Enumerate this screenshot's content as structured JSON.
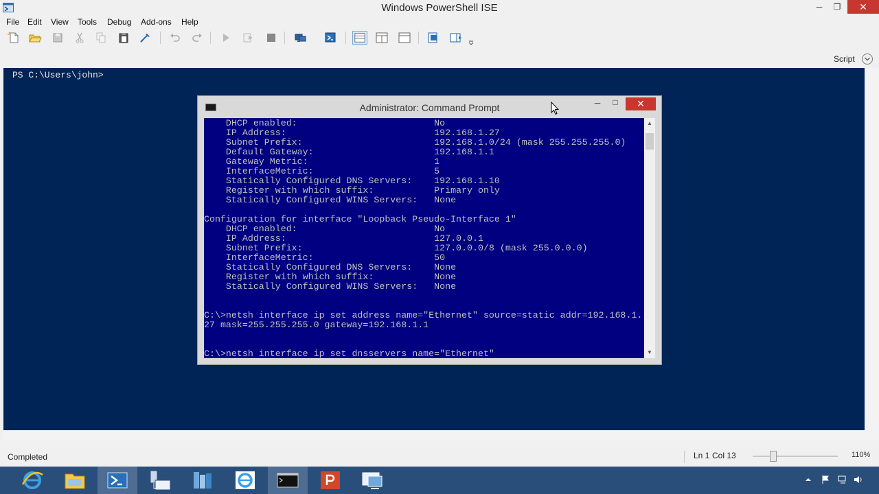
{
  "window": {
    "title": "Windows PowerShell ISE",
    "min_glyph": "─",
    "max_glyph": "❐",
    "close_glyph": "✕"
  },
  "menu": [
    "File",
    "Edit",
    "View",
    "Tools",
    "Debug",
    "Add-ons",
    "Help"
  ],
  "toolbar_icons": [
    "new-file-icon",
    "open-folder-icon",
    "save-icon",
    "cut-icon",
    "copy-icon",
    "paste-icon",
    "clear-console-icon",
    "undo-icon",
    "redo-icon",
    "run-script-icon",
    "run-selection-icon",
    "stop-icon",
    "new-remote-tab-icon",
    "start-powershell-icon",
    "script-pane-top-icon",
    "script-pane-right-icon",
    "script-pane-maximized-icon",
    "show-command-icon",
    "show-addon-icon",
    "toolbar-overflow-icon"
  ],
  "script_toggle": {
    "label": "Script"
  },
  "console": {
    "prompt": "PS C:\\Users\\john>"
  },
  "cmd": {
    "title": "Administrator: Command Prompt",
    "min_glyph": "─",
    "max_glyph": "□",
    "close_glyph": "✕",
    "lines": [
      "    DHCP enabled:                         No",
      "    IP Address:                           192.168.1.27",
      "    Subnet Prefix:                        192.168.1.0/24 (mask 255.255.255.0)",
      "    Default Gateway:                      192.168.1.1",
      "    Gateway Metric:                       1",
      "    InterfaceMetric:                      5",
      "    Statically Configured DNS Servers:    192.168.1.10",
      "    Register with which suffix:           Primary only",
      "    Statically Configured WINS Servers:   None",
      "",
      "Configuration for interface \"Loopback Pseudo-Interface 1\"",
      "    DHCP enabled:                         No",
      "    IP Address:                           127.0.0.1",
      "    Subnet Prefix:                        127.0.0.0/8 (mask 255.0.0.0)",
      "    InterfaceMetric:                      50",
      "    Statically Configured DNS Servers:    None",
      "    Register with which suffix:           None",
      "    Statically Configured WINS Servers:   None",
      "",
      "",
      "C:\\>netsh interface ip set address name=\"Ethernet\" source=static addr=192.168.1.",
      "27 mask=255.255.255.0 gateway=192.168.1.1",
      "",
      "",
      "C:\\>netsh interface ip set dnsservers name=\"Ethernet\""
    ]
  },
  "status": {
    "text": "Completed",
    "line": "Ln 1",
    "col": "Col 13",
    "zoom": "110%",
    "zoom_percent": 110
  },
  "taskbar": {
    "apps": [
      {
        "name": "taskbar-internet-explorer",
        "icon": "ie-icon",
        "active": false
      },
      {
        "name": "taskbar-file-explorer",
        "icon": "folder-icon",
        "active": false
      },
      {
        "name": "taskbar-powershell",
        "icon": "powershell-icon",
        "active": true
      },
      {
        "name": "taskbar-network",
        "icon": "network-computer-icon",
        "active": false
      },
      {
        "name": "taskbar-server-manager",
        "icon": "server-manager-icon",
        "active": false
      },
      {
        "name": "taskbar-internet-explorer-2",
        "icon": "ie-icon",
        "active": false
      },
      {
        "name": "taskbar-command-prompt",
        "icon": "cmd-icon",
        "active": true
      },
      {
        "name": "taskbar-powerpoint",
        "icon": "powerpoint-icon",
        "active": false
      },
      {
        "name": "taskbar-remote-desktop",
        "icon": "remote-desktop-icon",
        "active": false
      }
    ],
    "tray_icons": [
      "show-hidden-icons-icon",
      "action-center-flag-icon",
      "network-icon",
      "volume-icon"
    ]
  }
}
